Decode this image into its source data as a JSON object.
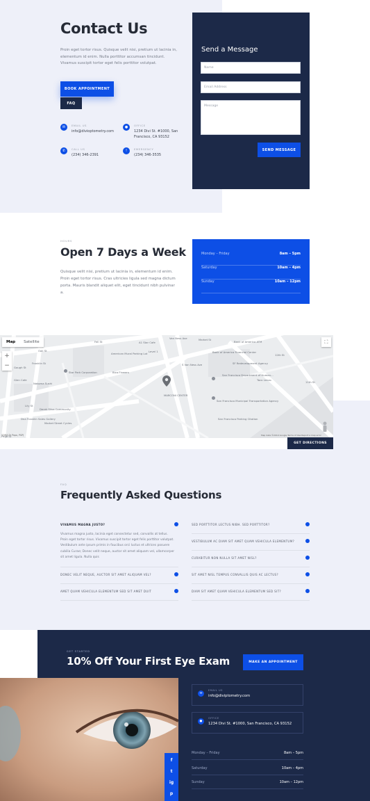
{
  "contact": {
    "title": "Contact Us",
    "text": "Proin eget tortor risus. Quisque velit nisi, pretium ut lacinia in, elementum id enim. Nulla porttitor accumsan tincidunt. Vivamus suscipit tortor eget felis porttitor volutpat.",
    "book_button": "BOOK APPOINTMENT",
    "faq_button": "FAQ",
    "items": [
      {
        "label": "EMAIL US",
        "value": "info@divioptometry.com",
        "icon": "email-icon"
      },
      {
        "label": "OFFICE",
        "value": "1234 Divi St. #1000, San Francisco, CA 93152",
        "icon": "location-icon"
      },
      {
        "label": "CALL US",
        "value": "(234) 346-2391",
        "icon": "phone-icon"
      },
      {
        "label": "EMERGENCY",
        "value": "(234) 346-3535",
        "icon": "emergency-icon"
      }
    ]
  },
  "form": {
    "title": "Send a Message",
    "name_placeholder": "Name",
    "email_placeholder": "Email Address",
    "message_placeholder": "Message",
    "submit": "SEND MESSAGE"
  },
  "hours": {
    "eyebrow": "HOURS",
    "title": "Open 7 Days a Week",
    "text": "Quisque velit nisi, pretium ut lacinia in, elementum id enim. Proin eget tortor risus. Cras ultricies ligula sed magna dictum porta. Mauris blandit aliquet elit, eget tincidunt nibh pulvinar a.",
    "rows": [
      {
        "day": "Monday – Friday",
        "time": "8am – 5pm"
      },
      {
        "day": "Saturday",
        "time": "10am – 4pm"
      },
      {
        "day": "Sunday",
        "time": "10am – 12pm"
      }
    ]
  },
  "map": {
    "tab_map": "Map",
    "tab_satellite": "Satellite",
    "zoom_in": "+",
    "zoom_out": "−",
    "footer": "Map data ©2019 Google   Terms of Use   Report a map error",
    "footer_left": "SOMA Dr Papo, PGPJ",
    "directions_button": "GET DIRECTIONS",
    "labels": [
      "Bank of America ATM",
      "Bank of America Financial Center",
      "SF Redevelopment Agency",
      "San Francisco Department of Human...",
      "Taco Lenzo",
      "San Francisco Municipal Transportation Agency",
      "San Francisco Parking Citation",
      "American Mural Parking Lot",
      "Star Park Corporation",
      "Bica Flowers",
      "Nakoma Sushi",
      "Derek Silva Community",
      "Market Street Cycles",
      "Glen Cafe",
      "Dna Franklin Sales Gallery",
      "A1 Star Cafe",
      "MARCONI CENTER",
      "Level 1",
      "Van Ness Ave",
      "S Van Ness Ave",
      "Market St",
      "Oak St",
      "Fell St",
      "Page St",
      "Lily St",
      "Franklin St",
      "Gough St",
      "11th St",
      "12th St"
    ]
  },
  "faq": {
    "eyebrow": "FAQ",
    "title": "Frequently Asked Questions",
    "left": [
      "VIVAMUS MAGNA JUSTO?",
      "DONEC VELIT NEQUE, AUCTOR SIT AMET ALIQUAM VEL?",
      "AMET QUAM VEHICULA ELEMENTUM SED SIT AMET DUIT"
    ],
    "answer": "Vivamus magna justo, lacinia eget consectetur sed, convallis at tellus. Proin eget tortor risus. Vivamus suscipit tortor eget felis porttitor volutpat. Vestibulum ante ipsum primis in faucibus orci luctus et ultrices posuere cubilia Curae; Donec velit neque, auctor sit amet aliquam vel, ullamcorper sit amet ligula. Nulla quis",
    "right": [
      "SED PORTTITOR LECTUS NIBH. SED PORTTITOR?",
      "VESTIBULUM AC DIAM SIT AMET QUAM VEHICULA ELEMENTUM?",
      "CURABITUR NON NULLA SIT AMET NISL?",
      "SIT AMET NISL TEMPUS CONVALLIS QUIS AC LECTUS?",
      "DIAM SIT AMET QUAM VEHICULA ELEMENTUM SED SIT?"
    ]
  },
  "cta": {
    "eyebrow": "GET STARTED",
    "title": "10% Off Your First Eye Exam",
    "button": "MAKE AN APPOINTMENT",
    "email_label": "EMAIL US",
    "email_value": "info@diviptometry.com",
    "office_label": "OFFICE",
    "office_value": "1234 Divi St. #1000, San Francisco, CA 93152",
    "rows": [
      {
        "day": "Monday – Friday",
        "time": "8am – 5pm"
      },
      {
        "day": "Saturday",
        "time": "10am – 4pm"
      },
      {
        "day": "Sunday",
        "time": "10am – 12pm"
      }
    ],
    "social": [
      "f",
      "t",
      "ig",
      "p"
    ]
  },
  "colors": {
    "accent": "#0d4fe6",
    "navy": "#1c2948",
    "light_bg": "#eef0f9"
  }
}
